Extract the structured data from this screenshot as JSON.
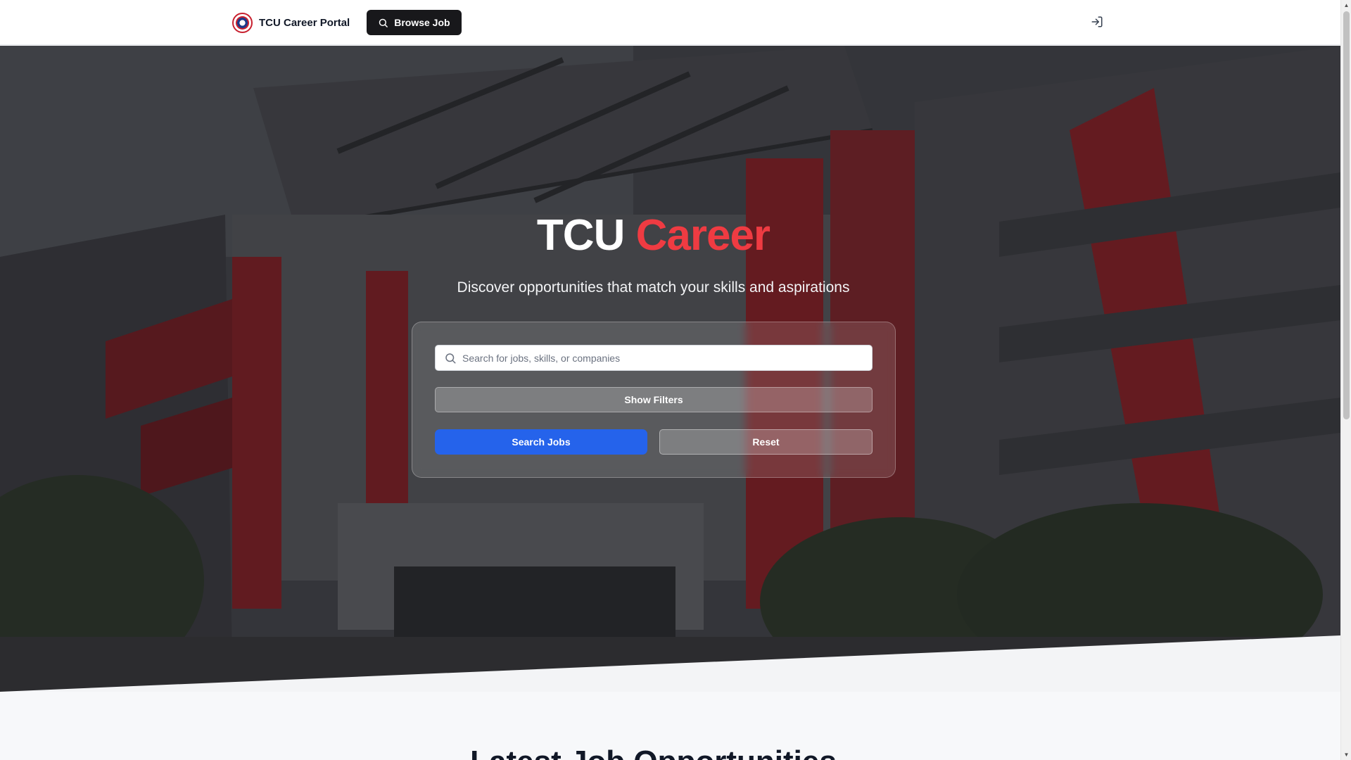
{
  "navbar": {
    "brand": "TCU Career Portal",
    "browse_label": "Browse Job",
    "login_icon": "log-in-icon"
  },
  "hero": {
    "title_main": "TCU",
    "title_accent": "Career",
    "subtitle": "Discover opportunities that match your skills and aspirations",
    "search": {
      "placeholder": "Search for jobs, skills, or companies",
      "value": ""
    },
    "show_filters_label": "Show Filters",
    "search_jobs_label": "Search Jobs",
    "reset_label": "Reset"
  },
  "latest": {
    "title": "Latest Job Opportunities"
  },
  "colors": {
    "accent_red": "#ef3b42",
    "primary_blue": "#2563eb",
    "dark_button": "#18181b"
  }
}
